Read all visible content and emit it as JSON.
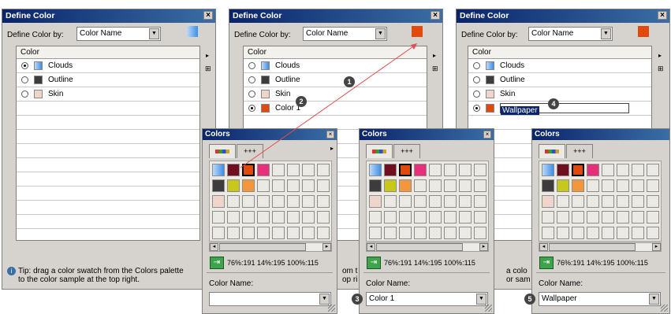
{
  "define_dialog": {
    "title": "Define Color",
    "close": "×",
    "define_by_label": "Define Color by:",
    "define_by_value": "Color Name",
    "dropdown_arrow": "▼",
    "list_header": "Color",
    "side_arrow": "▸",
    "side_pin": "⊞"
  },
  "rows_panel1": [
    {
      "label": "Clouds",
      "color": "gradient-blue",
      "selected": true
    },
    {
      "label": "Outline",
      "color": "#3c3c3c",
      "selected": false
    },
    {
      "label": "Skin",
      "color": "#efd5cc",
      "selected": false
    }
  ],
  "rows_panel2": [
    {
      "label": "Clouds",
      "color": "gradient-blue",
      "selected": false
    },
    {
      "label": "Outline",
      "color": "#3c3c3c",
      "selected": false
    },
    {
      "label": "Skin",
      "color": "#efd5cc",
      "selected": false
    },
    {
      "label": "Color 1",
      "color": "#e04a0c",
      "selected": true
    }
  ],
  "rows_panel3": [
    {
      "label": "Clouds",
      "color": "gradient-blue",
      "selected": false
    },
    {
      "label": "Outline",
      "color": "#3c3c3c",
      "selected": false
    },
    {
      "label": "Skin",
      "color": "#efd5cc",
      "selected": false
    },
    {
      "label": "Wallpaper",
      "color": "#e04a0c",
      "selected": true,
      "editing": true
    }
  ],
  "tip": {
    "icon": "i",
    "line1": "Tip: drag a color swatch  from the Colors palette",
    "line2": "to the color sample at the top right.",
    "p2_line1": "om t",
    "p2_line2": "op ri",
    "p3_line1": "a colo",
    "p3_line2": "or sam"
  },
  "colors_palette": {
    "title": "Colors",
    "close": "×",
    "tab1_icon": "swatches-tab-icon",
    "tab2_label": "+++",
    "more_arrow": "▸",
    "coords": "76%:191 14%:195 100%:115",
    "name_label": "Color Name:",
    "scroll_left": "◂",
    "scroll_right": "▸",
    "add_icon": "⇥",
    "swatches": [
      "gradient-blue",
      "#6e0e1e",
      "#e04a0c",
      "#e8307a",
      "#3c3c3c",
      "#c8c81a",
      "#f4963c",
      "#efd5cc"
    ]
  },
  "palette_names": [
    "",
    "Color 1",
    "Wallpaper"
  ],
  "badges": [
    "1",
    "2",
    "3",
    "4",
    "5"
  ],
  "colors": {
    "sample_panel1": "gradient-blue",
    "sample_panel23": "#e04a0c",
    "title_bg": "#0a246a",
    "panel_bg": "#d6d3ce",
    "arrow": "#e05050"
  }
}
